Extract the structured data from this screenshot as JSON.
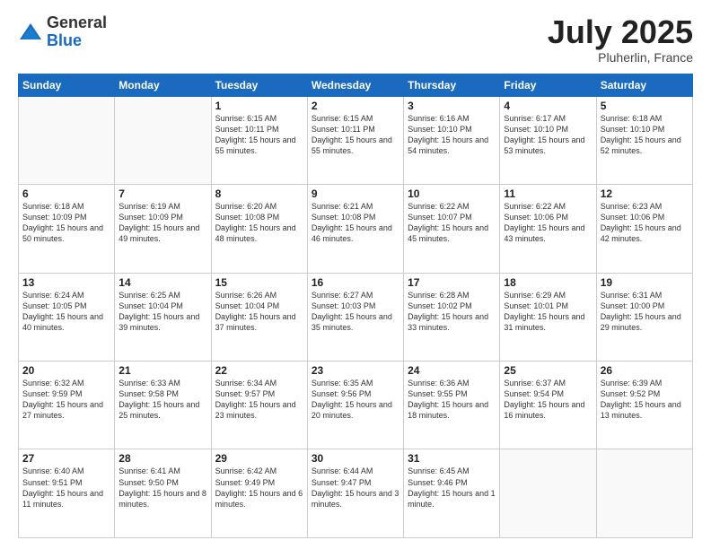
{
  "header": {
    "logo": {
      "general": "General",
      "blue": "Blue"
    },
    "title": "July 2025",
    "location": "Pluherlin, France"
  },
  "days_of_week": [
    "Sunday",
    "Monday",
    "Tuesday",
    "Wednesday",
    "Thursday",
    "Friday",
    "Saturday"
  ],
  "weeks": [
    [
      {
        "day": "",
        "info": ""
      },
      {
        "day": "",
        "info": ""
      },
      {
        "day": "1",
        "info": "Sunrise: 6:15 AM\nSunset: 10:11 PM\nDaylight: 15 hours and 55 minutes."
      },
      {
        "day": "2",
        "info": "Sunrise: 6:15 AM\nSunset: 10:11 PM\nDaylight: 15 hours and 55 minutes."
      },
      {
        "day": "3",
        "info": "Sunrise: 6:16 AM\nSunset: 10:10 PM\nDaylight: 15 hours and 54 minutes."
      },
      {
        "day": "4",
        "info": "Sunrise: 6:17 AM\nSunset: 10:10 PM\nDaylight: 15 hours and 53 minutes."
      },
      {
        "day": "5",
        "info": "Sunrise: 6:18 AM\nSunset: 10:10 PM\nDaylight: 15 hours and 52 minutes."
      }
    ],
    [
      {
        "day": "6",
        "info": "Sunrise: 6:18 AM\nSunset: 10:09 PM\nDaylight: 15 hours and 50 minutes."
      },
      {
        "day": "7",
        "info": "Sunrise: 6:19 AM\nSunset: 10:09 PM\nDaylight: 15 hours and 49 minutes."
      },
      {
        "day": "8",
        "info": "Sunrise: 6:20 AM\nSunset: 10:08 PM\nDaylight: 15 hours and 48 minutes."
      },
      {
        "day": "9",
        "info": "Sunrise: 6:21 AM\nSunset: 10:08 PM\nDaylight: 15 hours and 46 minutes."
      },
      {
        "day": "10",
        "info": "Sunrise: 6:22 AM\nSunset: 10:07 PM\nDaylight: 15 hours and 45 minutes."
      },
      {
        "day": "11",
        "info": "Sunrise: 6:22 AM\nSunset: 10:06 PM\nDaylight: 15 hours and 43 minutes."
      },
      {
        "day": "12",
        "info": "Sunrise: 6:23 AM\nSunset: 10:06 PM\nDaylight: 15 hours and 42 minutes."
      }
    ],
    [
      {
        "day": "13",
        "info": "Sunrise: 6:24 AM\nSunset: 10:05 PM\nDaylight: 15 hours and 40 minutes."
      },
      {
        "day": "14",
        "info": "Sunrise: 6:25 AM\nSunset: 10:04 PM\nDaylight: 15 hours and 39 minutes."
      },
      {
        "day": "15",
        "info": "Sunrise: 6:26 AM\nSunset: 10:04 PM\nDaylight: 15 hours and 37 minutes."
      },
      {
        "day": "16",
        "info": "Sunrise: 6:27 AM\nSunset: 10:03 PM\nDaylight: 15 hours and 35 minutes."
      },
      {
        "day": "17",
        "info": "Sunrise: 6:28 AM\nSunset: 10:02 PM\nDaylight: 15 hours and 33 minutes."
      },
      {
        "day": "18",
        "info": "Sunrise: 6:29 AM\nSunset: 10:01 PM\nDaylight: 15 hours and 31 minutes."
      },
      {
        "day": "19",
        "info": "Sunrise: 6:31 AM\nSunset: 10:00 PM\nDaylight: 15 hours and 29 minutes."
      }
    ],
    [
      {
        "day": "20",
        "info": "Sunrise: 6:32 AM\nSunset: 9:59 PM\nDaylight: 15 hours and 27 minutes."
      },
      {
        "day": "21",
        "info": "Sunrise: 6:33 AM\nSunset: 9:58 PM\nDaylight: 15 hours and 25 minutes."
      },
      {
        "day": "22",
        "info": "Sunrise: 6:34 AM\nSunset: 9:57 PM\nDaylight: 15 hours and 23 minutes."
      },
      {
        "day": "23",
        "info": "Sunrise: 6:35 AM\nSunset: 9:56 PM\nDaylight: 15 hours and 20 minutes."
      },
      {
        "day": "24",
        "info": "Sunrise: 6:36 AM\nSunset: 9:55 PM\nDaylight: 15 hours and 18 minutes."
      },
      {
        "day": "25",
        "info": "Sunrise: 6:37 AM\nSunset: 9:54 PM\nDaylight: 15 hours and 16 minutes."
      },
      {
        "day": "26",
        "info": "Sunrise: 6:39 AM\nSunset: 9:52 PM\nDaylight: 15 hours and 13 minutes."
      }
    ],
    [
      {
        "day": "27",
        "info": "Sunrise: 6:40 AM\nSunset: 9:51 PM\nDaylight: 15 hours and 11 minutes."
      },
      {
        "day": "28",
        "info": "Sunrise: 6:41 AM\nSunset: 9:50 PM\nDaylight: 15 hours and 8 minutes."
      },
      {
        "day": "29",
        "info": "Sunrise: 6:42 AM\nSunset: 9:49 PM\nDaylight: 15 hours and 6 minutes."
      },
      {
        "day": "30",
        "info": "Sunrise: 6:44 AM\nSunset: 9:47 PM\nDaylight: 15 hours and 3 minutes."
      },
      {
        "day": "31",
        "info": "Sunrise: 6:45 AM\nSunset: 9:46 PM\nDaylight: 15 hours and 1 minute."
      },
      {
        "day": "",
        "info": ""
      },
      {
        "day": "",
        "info": ""
      }
    ]
  ]
}
